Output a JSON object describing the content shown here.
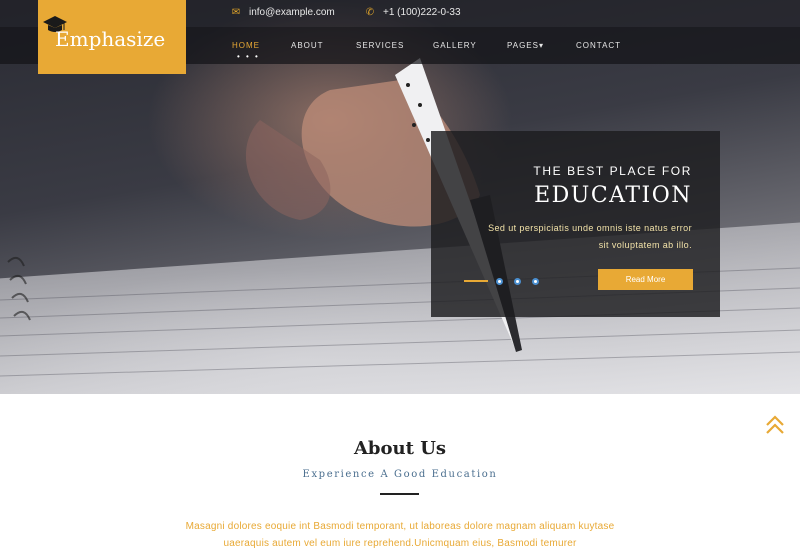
{
  "topbar": {
    "email": "info@example.com",
    "phone": "+1 (100)222-0-33",
    "email_icon": "envelope-icon",
    "phone_icon": "phone-icon"
  },
  "logo": {
    "text": "Emphasize",
    "icon": "graduation-cap-icon"
  },
  "nav": {
    "items": [
      "HOME",
      "ABOUT",
      "SERVICES",
      "GALLERY",
      "PAGES",
      "CONTACT"
    ],
    "active": "HOME",
    "active_marker": "• • •",
    "dropdown_indicator": "▾"
  },
  "hero": {
    "subtitle": "THE BEST PLACE FOR",
    "title": "EDUCATION",
    "text_line1": "Sed ut perspiciatis unde omnis iste natus error",
    "text_line2": "sit voluptatem ab illo.",
    "button": "Read More",
    "slide_count": 4,
    "active_slide": 1
  },
  "about": {
    "title": "About Us",
    "subtitle": "Experience A Good Education",
    "text_line1": "Masagni dolores eoquie int Basmodi temporant, ut laboreas dolore magnam aliquam kuytase",
    "text_line2": "uaeraquis autem vel eum iure reprehend.Unicmquam eius, Basmodi temurer"
  },
  "scroll_top_icon": "double-chevron-up-icon",
  "colors": {
    "accent": "#e8a935",
    "subtitle_blue": "#4b6f8f",
    "slider_dot_border": "#4a8fd0"
  }
}
